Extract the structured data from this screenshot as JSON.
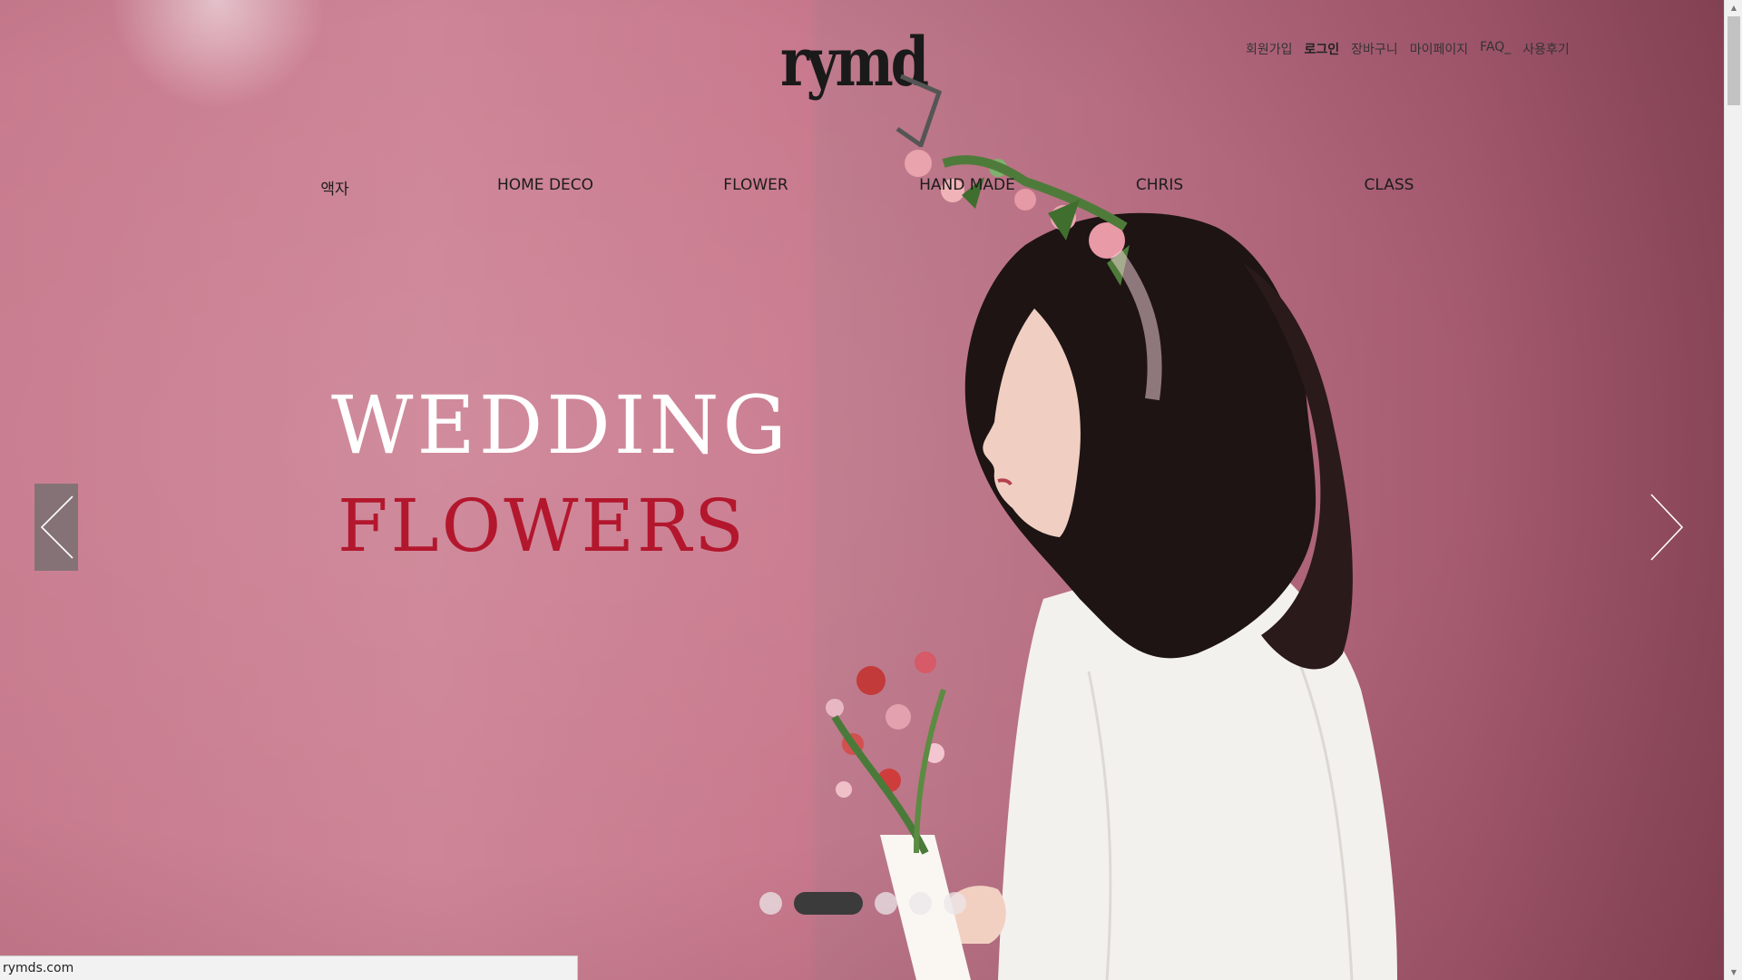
{
  "logo": {
    "text": "rymd"
  },
  "util_links": [
    {
      "label": "회원가입",
      "bold": false
    },
    {
      "label": "로그인",
      "bold": true
    },
    {
      "label": "장바구니",
      "bold": false
    },
    {
      "label": "마이페이지",
      "bold": false
    },
    {
      "label": "FAQ_",
      "bold": false
    },
    {
      "label": "사용후기",
      "bold": false
    }
  ],
  "nav": [
    {
      "label": "액자"
    },
    {
      "label": "HOME DECO"
    },
    {
      "label": "FLOWER"
    },
    {
      "label": "HAND MADE"
    },
    {
      "label": "CHRIS"
    },
    {
      "label": "CLASS"
    }
  ],
  "hero": {
    "title_line1": "WEDDING",
    "title_line2": "FLOWERS",
    "title_line1_color": "#ffffff",
    "title_line2_color": "#b3172d",
    "background_color": "#c97f93"
  },
  "slider": {
    "slide_count": 5,
    "active_index": 1,
    "prev_icon": "chevron-left-icon",
    "next_icon": "chevron-right-icon"
  },
  "status_bar": {
    "url": "rymds.com"
  },
  "scrollbar": {
    "up_icon": "triangle-up-icon",
    "down_icon": "triangle-down-icon"
  }
}
